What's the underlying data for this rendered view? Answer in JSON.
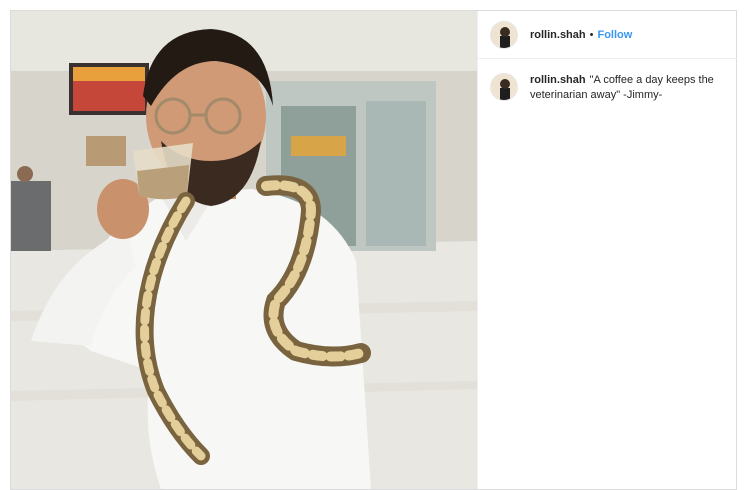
{
  "post": {
    "username": "rollin.shah",
    "separator": "•",
    "follow_label": "Follow",
    "caption": {
      "username": "rollin.shah",
      "text": "\"A coffee a day keeps the veterinarian away\" -Jimmy-"
    },
    "photo_icon": "man-holding-coffee-with-snake-photo",
    "avatar_icon": "profile-avatar"
  },
  "colors": {
    "link_blue": "#3897f0",
    "text_dark": "#262626",
    "border": "#dbdbdb"
  }
}
